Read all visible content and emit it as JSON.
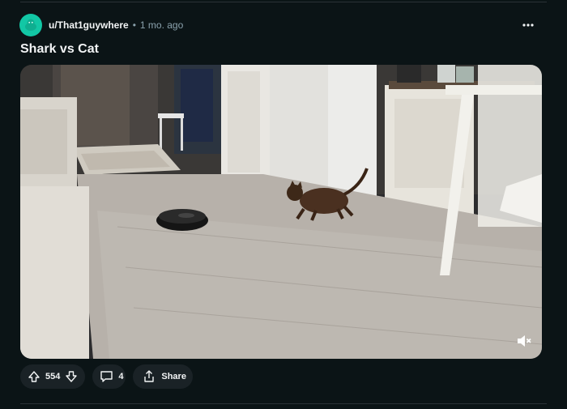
{
  "post": {
    "author": "u/That1guywhere",
    "separator": "•",
    "time": "1 mo. ago",
    "title": "Shark vs Cat",
    "overflow_icon": "more-horizontal-icon"
  },
  "media": {
    "type": "video",
    "muted": true,
    "mute_icon": "volume-muted-icon"
  },
  "actions": {
    "score": "554",
    "comments": "4",
    "share_label": "Share"
  },
  "colors": {
    "background": "#0b1416",
    "avatar": "#12c7a5",
    "pill": "#1a2226",
    "muted_text": "#8ba2ad"
  }
}
